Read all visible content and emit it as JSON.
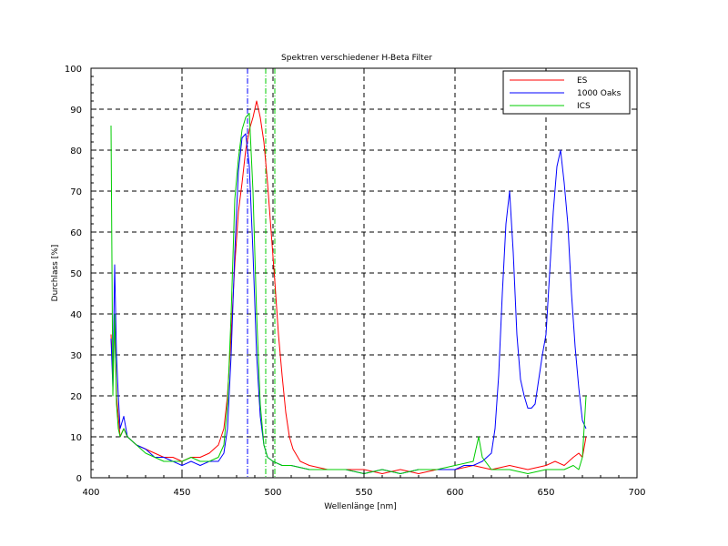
{
  "chart_data": {
    "type": "line",
    "title": "Spektren verschiedener H-Beta Filter",
    "xlabel": "Wellenlänge [nm]",
    "ylabel": "Durchlass [%]",
    "xlim": [
      400,
      700
    ],
    "ylim": [
      0,
      100
    ],
    "x_ticks": [
      400,
      450,
      500,
      550,
      600,
      650,
      700
    ],
    "y_ticks": [
      0,
      10,
      20,
      30,
      40,
      50,
      60,
      70,
      80,
      90,
      100
    ],
    "grid": "dashed",
    "legend_position": "top-right",
    "series": [
      {
        "name": "ES",
        "color": "#ff0000",
        "x": [
          411,
          412,
          413,
          414,
          415,
          416,
          418,
          420,
          425,
          430,
          435,
          440,
          445,
          450,
          455,
          460,
          465,
          470,
          473,
          475,
          477,
          479,
          481,
          483,
          485,
          487,
          489,
          491,
          493,
          495,
          497,
          499,
          501,
          503,
          505,
          507,
          509,
          511,
          515,
          520,
          530,
          540,
          550,
          560,
          570,
          580,
          590,
          600,
          610,
          620,
          630,
          640,
          650,
          655,
          660,
          665,
          668,
          670,
          672
        ],
        "y": [
          35,
          25,
          38,
          20,
          15,
          10,
          12,
          10,
          8,
          7,
          6,
          5,
          5,
          4,
          5,
          5,
          6,
          8,
          12,
          20,
          35,
          52,
          65,
          72,
          80,
          85,
          88,
          92,
          88,
          82,
          72,
          60,
          48,
          35,
          25,
          16,
          10,
          7,
          4,
          3,
          2,
          2,
          2,
          1,
          2,
          1,
          2,
          2,
          3,
          2,
          3,
          2,
          3,
          4,
          3,
          5,
          6,
          5,
          10
        ]
      },
      {
        "name": "1000 Oaks",
        "color": "#0000ff",
        "x": [
          411,
          412,
          413,
          414,
          415,
          416,
          418,
          420,
          425,
          430,
          435,
          440,
          445,
          450,
          455,
          460,
          465,
          470,
          473,
          475,
          477,
          479,
          481,
          483,
          485,
          487,
          489,
          491,
          493,
          495,
          497,
          500,
          505,
          510,
          520,
          530,
          540,
          550,
          560,
          570,
          580,
          590,
          600,
          605,
          610,
          615,
          620,
          622,
          624,
          626,
          628,
          630,
          632,
          634,
          636,
          638,
          640,
          642,
          644,
          646,
          648,
          650,
          652,
          654,
          656,
          658,
          660,
          662,
          664,
          666,
          668,
          670,
          672
        ],
        "y": [
          34,
          22,
          52,
          30,
          20,
          12,
          15,
          10,
          8,
          7,
          5,
          5,
          4,
          3,
          4,
          3,
          4,
          4,
          6,
          12,
          30,
          55,
          75,
          83,
          84,
          76,
          55,
          30,
          15,
          8,
          5,
          4,
          3,
          3,
          2,
          2,
          2,
          1,
          2,
          1,
          2,
          2,
          2,
          3,
          3,
          4,
          6,
          12,
          25,
          45,
          62,
          70,
          55,
          35,
          24,
          20,
          17,
          17,
          18,
          24,
          30,
          35,
          50,
          65,
          76,
          80,
          72,
          62,
          45,
          32,
          22,
          14,
          12
        ]
      },
      {
        "name": "ICS",
        "color": "#00cc00",
        "x": [
          411,
          412,
          413,
          414,
          415,
          416,
          418,
          420,
          425,
          430,
          435,
          440,
          445,
          450,
          455,
          460,
          465,
          470,
          473,
          475,
          477,
          479,
          481,
          483,
          485,
          487,
          489,
          491,
          493,
          495,
          497,
          500,
          505,
          510,
          520,
          530,
          540,
          550,
          560,
          570,
          580,
          590,
          600,
          610,
          613,
          615,
          620,
          630,
          640,
          650,
          660,
          665,
          668,
          670,
          672
        ],
        "y": [
          86,
          20,
          40,
          18,
          12,
          10,
          12,
          10,
          8,
          6,
          5,
          4,
          4,
          4,
          5,
          4,
          4,
          5,
          8,
          18,
          40,
          68,
          78,
          85,
          88,
          89,
          70,
          40,
          18,
          8,
          5,
          4,
          3,
          3,
          2,
          2,
          2,
          1,
          2,
          1,
          2,
          2,
          3,
          4,
          10,
          5,
          2,
          2,
          1,
          2,
          2,
          3,
          2,
          5,
          20
        ]
      }
    ],
    "vertical_lines": [
      {
        "x": 486,
        "color": "#0000ff",
        "style": "dash-dot"
      },
      {
        "x": 496,
        "color": "#00cc00",
        "style": "dash-dot"
      },
      {
        "x": 501,
        "color": "#00cc00",
        "style": "dash-dot"
      }
    ]
  }
}
